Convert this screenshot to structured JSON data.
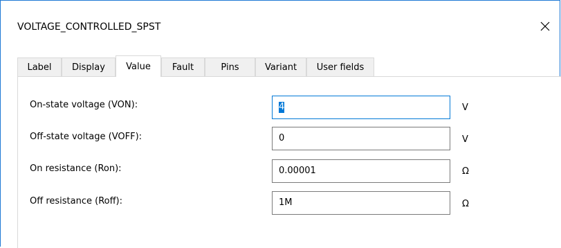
{
  "window": {
    "title": "VOLTAGE_CONTROLLED_SPST"
  },
  "tabs": [
    {
      "label": "Label"
    },
    {
      "label": "Display"
    },
    {
      "label": "Value",
      "active": true
    },
    {
      "label": "Fault"
    },
    {
      "label": "Pins"
    },
    {
      "label": "Variant"
    },
    {
      "label": "User fields"
    }
  ],
  "parameters": [
    {
      "label": "On-state voltage (VON):",
      "value": "4",
      "unit": "V",
      "focused": true
    },
    {
      "label": "Off-state voltage (VOFF):",
      "value": "0",
      "unit": "V"
    },
    {
      "label": "On resistance (Ron):",
      "value": "0.00001",
      "unit": "Ω"
    },
    {
      "label": "Off resistance (Roff):",
      "value": "1M",
      "unit": "Ω"
    }
  ],
  "colors": {
    "accent": "#0078d7",
    "window_border": "#1e78d4",
    "tab_bg": "#f0f0f0"
  },
  "icons": {
    "close": "close-icon"
  }
}
